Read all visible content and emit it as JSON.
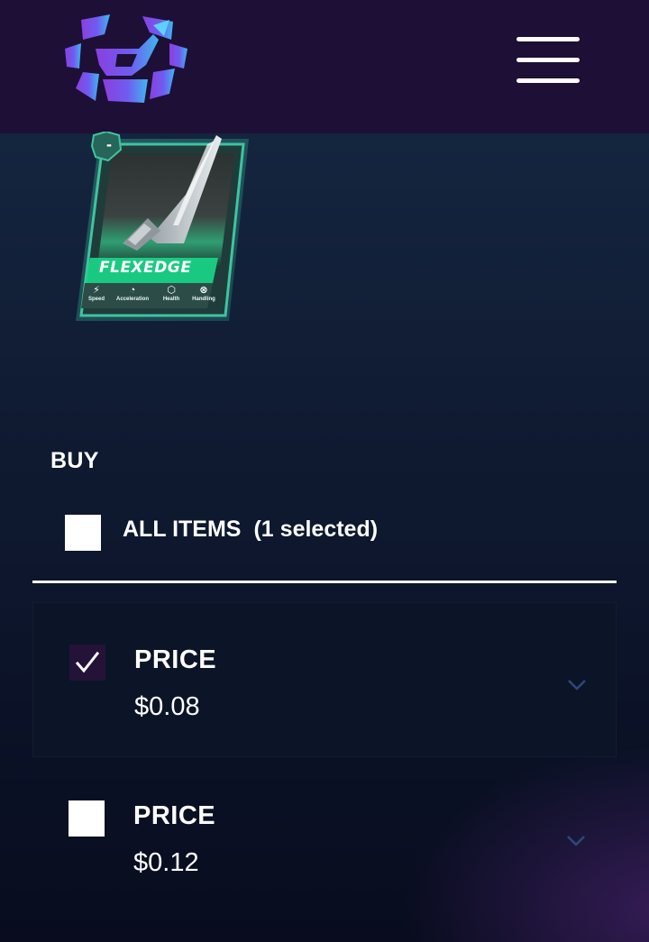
{
  "header": {
    "logo_icon": "rocket-hexagon-logo",
    "menu_icon": "hamburger-menu-icon"
  },
  "item_card": {
    "level_badge": "-",
    "name": "FLEXEDGE",
    "accent_color": "#19d88a",
    "stats": [
      {
        "label": "Speed",
        "icon": "lightning-icon"
      },
      {
        "label": "Acceleration",
        "icon": "speedometer-icon"
      },
      {
        "label": "Health",
        "icon": "shield-icon"
      },
      {
        "label": "Handling",
        "icon": "steering-wheel-icon"
      }
    ]
  },
  "buy": {
    "title": "BUY",
    "all_items_label": "ALL ITEMS",
    "selected_count_text": "(1 selected)",
    "all_items_checked": false
  },
  "listings": [
    {
      "label": "PRICE",
      "price": "$0.08",
      "checked": true
    },
    {
      "label": "PRICE",
      "price": "$0.12",
      "checked": false
    }
  ],
  "colors": {
    "header_bg": "#1e0f36",
    "checked_box": "#241239",
    "chevron": "#2a4a7a"
  }
}
